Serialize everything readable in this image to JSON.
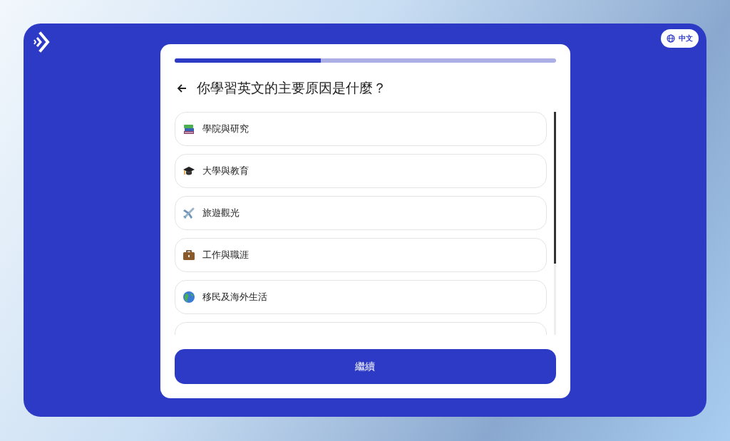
{
  "language_button": {
    "label": "中文"
  },
  "progress": {
    "level": 0.385
  },
  "question": {
    "title": "你學習英文的主要原因是什麼？"
  },
  "options": [
    {
      "kind": "books",
      "label": "學院與研究",
      "selected": false
    },
    {
      "kind": "cap",
      "label": "大學與教育",
      "selected": false
    },
    {
      "kind": "plane",
      "label": "旅遊觀光",
      "selected": false
    },
    {
      "kind": "briefcase",
      "label": "工作與職涯",
      "selected": false
    },
    {
      "kind": "globe",
      "label": "移民及海外生活",
      "selected": false
    }
  ],
  "continue_button": {
    "label": "繼續"
  }
}
